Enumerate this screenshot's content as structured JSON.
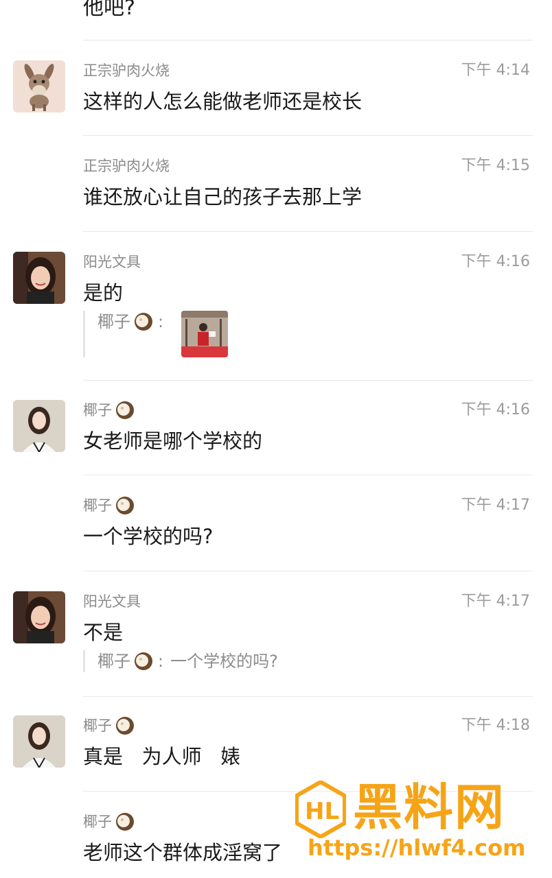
{
  "top_fragment": "他吧?",
  "messages": [
    {
      "sender": "正宗驴肉火烧",
      "time": "下午 4:14",
      "text": "这样的人怎么能做老师还是校长",
      "avatar": "donkey-avatar"
    },
    {
      "sender": "正宗驴肉火烧",
      "time": "下午 4:15",
      "text": "谁还放心让自己的孩子去那上学"
    },
    {
      "sender": "阳光文具",
      "time": "下午 4:16",
      "text": "是的",
      "avatar": "woman-avatar",
      "quote": {
        "sender": "椰子",
        "colon": ":",
        "media": "photo-thumbnail"
      }
    },
    {
      "sender": "椰子",
      "time": "下午 4:16",
      "text": "女老师是哪个学校的",
      "avatar": "woman-white-avatar",
      "sender_icon": "coconut-icon"
    },
    {
      "sender": "椰子",
      "time": "下午 4:17",
      "text": "一个学校的吗?",
      "sender_icon": "coconut-icon"
    },
    {
      "sender": "阳光文具",
      "time": "下午 4:17",
      "text": "不是",
      "avatar": "woman-avatar",
      "quote": {
        "sender": "椰子",
        "colon": ":",
        "text": "一个学校的吗?"
      }
    },
    {
      "sender": "椰子",
      "time": "下午 4:18",
      "text": "真是   为人师   婊",
      "avatar": "woman-white-avatar",
      "sender_icon": "coconut-icon"
    },
    {
      "sender": "椰子",
      "time": "",
      "text": "老师这个群体成淫窝了",
      "sender_icon": "coconut-icon"
    }
  ],
  "watermark": {
    "title": "黑料网",
    "url": "https://hlwf4.com",
    "color": "#f6a417"
  },
  "colors": {
    "name": "#8a8a8a",
    "time": "#9b9b9b",
    "text": "#1a1a1a",
    "divider": "#e8e8e8"
  }
}
